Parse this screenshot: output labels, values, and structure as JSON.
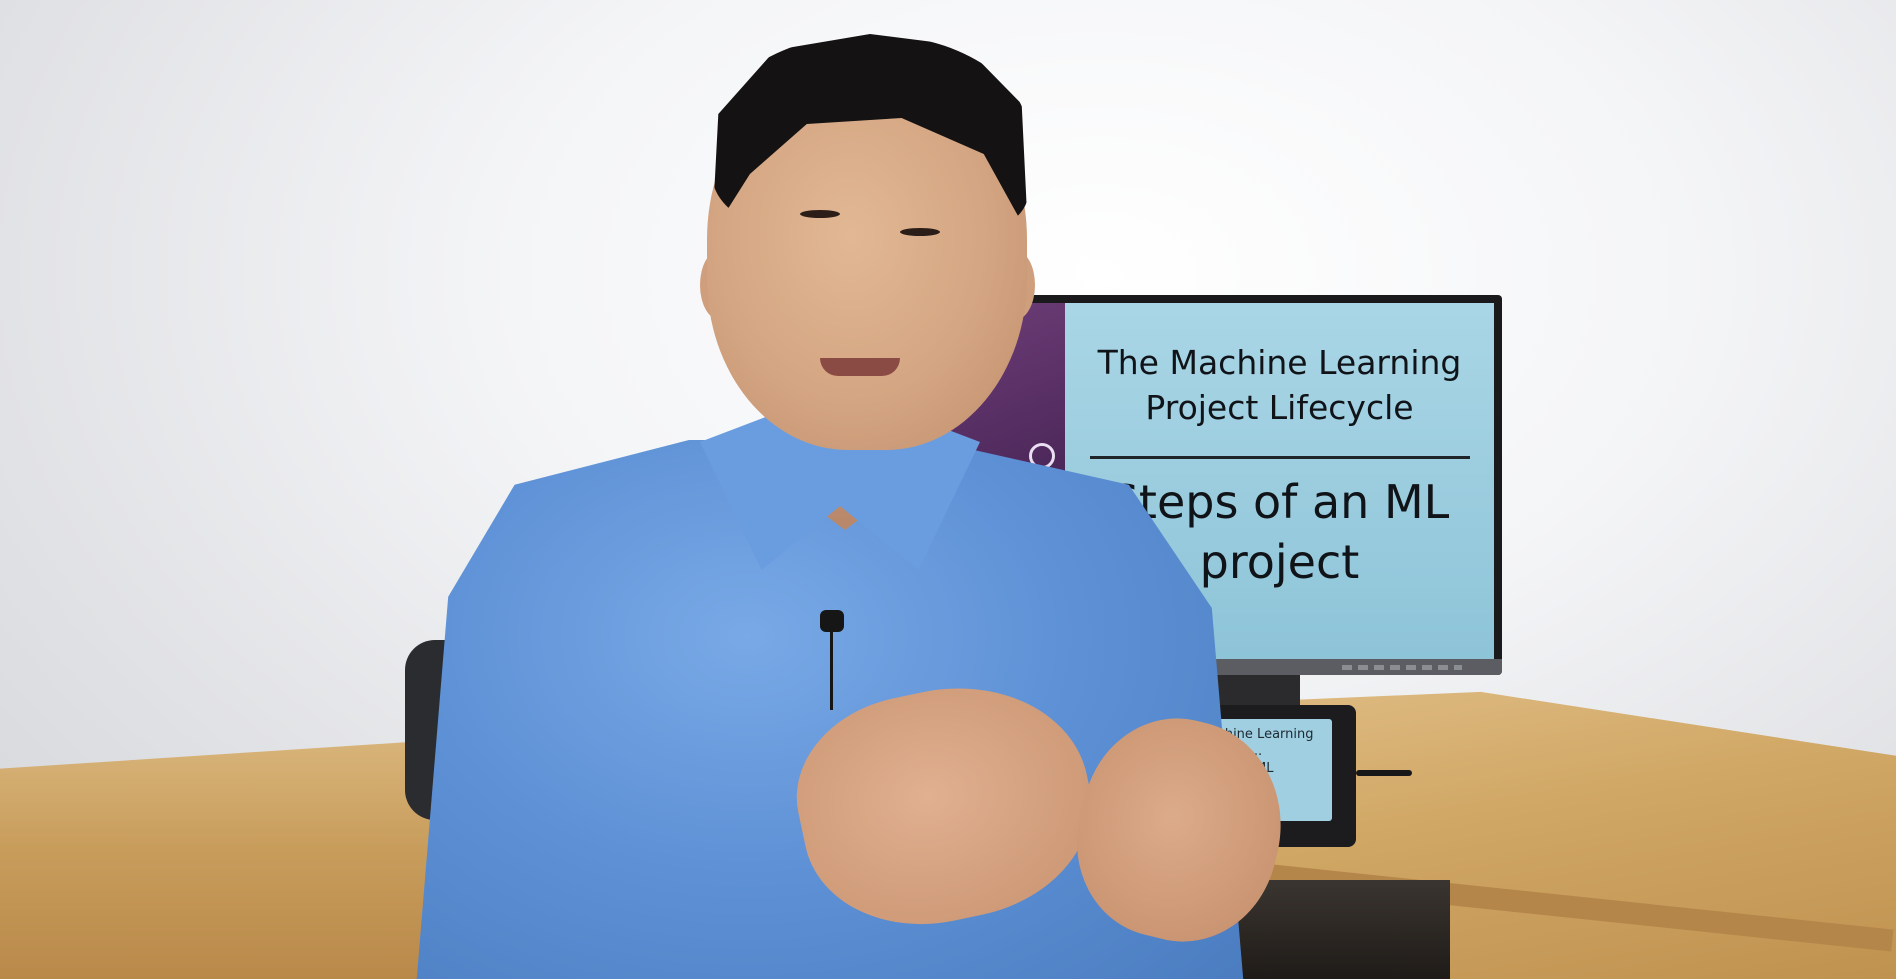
{
  "slide": {
    "title": "The Machine Learning\nProject Lifecycle",
    "subtitle": "Steps of an ML\nproject"
  },
  "tablet": {
    "text": "Machine Learning\n...\n... ML"
  },
  "colors": {
    "slide_background": "#9ccde0",
    "slide_stripe": "#4a2658",
    "shirt": "#5e91d6",
    "desk": "#d1a866"
  }
}
